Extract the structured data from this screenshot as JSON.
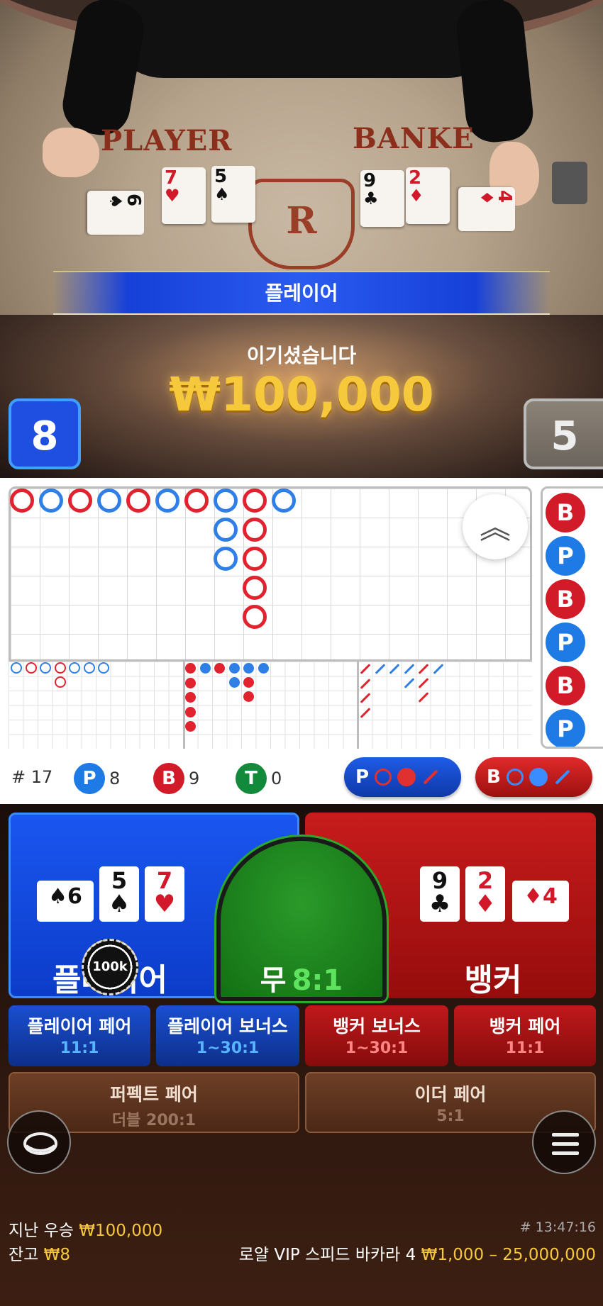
{
  "table": {
    "player_label": "PLAYER",
    "banker_label": "BANKE",
    "crest_letter": "R",
    "player_cards": [
      {
        "rank": "6",
        "suit": "♠"
      },
      {
        "rank": "7",
        "suit": "♥"
      },
      {
        "rank": "5",
        "suit": "♠"
      }
    ],
    "banker_cards": [
      {
        "rank": "9",
        "suit": "♣"
      },
      {
        "rank": "2",
        "suit": "♦"
      },
      {
        "rank": "4",
        "suit": "♦"
      }
    ]
  },
  "result": {
    "winner": "플레이어",
    "message": "이기셨습니다",
    "amount": "₩100,000",
    "player_score": "8",
    "banker_score": "5"
  },
  "stats": {
    "round_count": "# 17",
    "player_badge": "P",
    "player_count": "8",
    "banker_badge": "B",
    "banker_count": "9",
    "tie_badge": "T",
    "tie_count": "0",
    "player_predict": "P",
    "banker_predict": "B"
  },
  "bead_road": [
    "B",
    "P",
    "B",
    "P",
    "B",
    "P"
  ],
  "bets": {
    "player": "플레이어",
    "banker": "뱅커",
    "tie": "무",
    "tie_odds": "8:1",
    "chip": "100k",
    "player_hand": [
      {
        "rank": "5",
        "suit": "♠"
      },
      {
        "rank": "7",
        "suit": "♥"
      }
    ],
    "banker_hand": [
      {
        "rank": "9",
        "suit": "♣"
      },
      {
        "rank": "2",
        "suit": "♦"
      }
    ],
    "player_side_card": {
      "rank": "6",
      "suit": "♠"
    },
    "banker_side_card": {
      "rank": "4",
      "suit": "♦"
    },
    "side_bets": [
      {
        "title": "플레이어 페어",
        "odds": "11:1"
      },
      {
        "title": "플레이어 보너스",
        "odds": "1~30:1"
      },
      {
        "title": "뱅커 보너스",
        "odds": "1~30:1"
      },
      {
        "title": "뱅커 페어",
        "odds": "11:1"
      },
      {
        "title": "퍼펙트 페어",
        "odds": "더블 200:1"
      },
      {
        "title": "이더 페어",
        "odds": "5:1"
      }
    ]
  },
  "footer": {
    "last_win_label": "지난 우승",
    "last_win_amount": "₩100,000",
    "balance_label": "잔고",
    "balance_amount": "₩8",
    "round_id": "# 13:47:16",
    "table_name": "로얄 VIP 스피드 바카라 4",
    "bet_limits": "₩1,000 – 25,000,000"
  },
  "colors": {
    "player": "#1a56f0",
    "banker": "#c71c1c",
    "tie": "#137013",
    "gold": "#f6c83c"
  }
}
